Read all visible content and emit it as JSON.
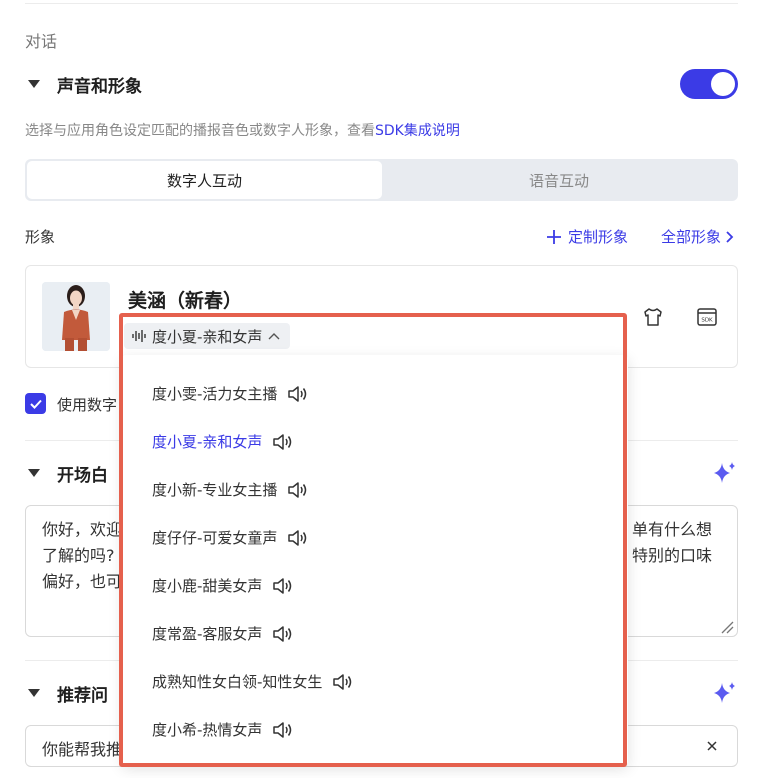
{
  "section": {
    "label": "对话"
  },
  "voice_group": {
    "title": "声音和形象",
    "toggle_on": true,
    "description_prefix": "选择与应用角色设定匹配的播报音色或数字人形象，查看",
    "description_link": "SDK集成说明"
  },
  "mode_tabs": [
    {
      "label": "数字人互动",
      "selected": true
    },
    {
      "label": "语音互动",
      "selected": false
    }
  ],
  "avatar_section": {
    "label": "形象",
    "custom_link": "定制形象",
    "all_link": "全部形象"
  },
  "avatar_card": {
    "name": "美涵（新春）",
    "voice": "度小夏-亲和女声",
    "icons": [
      "tshirt-icon",
      "sdk-icon"
    ]
  },
  "use_digital_checkbox": {
    "label": "使用数字",
    "checked": true
  },
  "opening": {
    "title": "开场白",
    "text_lines": [
      {
        "left": "你好，欢迎",
        "right": "单有什么想"
      },
      {
        "left": "了解的吗?",
        "right": "特别的口味"
      },
      {
        "left": "偏好，也可",
        "right": ""
      }
    ]
  },
  "recommend": {
    "title": "推荐问",
    "input_value": "你能帮我推"
  },
  "voice_dropdown": {
    "items": [
      {
        "label": "度小雯-活力女主播",
        "selected": false
      },
      {
        "label": "度小夏-亲和女声",
        "selected": true
      },
      {
        "label": "度小新-专业女主播",
        "selected": false
      },
      {
        "label": "度仔仔-可爱女童声",
        "selected": false
      },
      {
        "label": "度小鹿-甜美女声",
        "selected": false
      },
      {
        "label": "度常盈-客服女声",
        "selected": false
      },
      {
        "label": "成熟知性女白领-知性女生",
        "selected": false
      },
      {
        "label": "度小希-热情女声",
        "selected": false
      }
    ]
  },
  "colors": {
    "accent": "#3b3be6",
    "highlight": "#e5604d"
  }
}
